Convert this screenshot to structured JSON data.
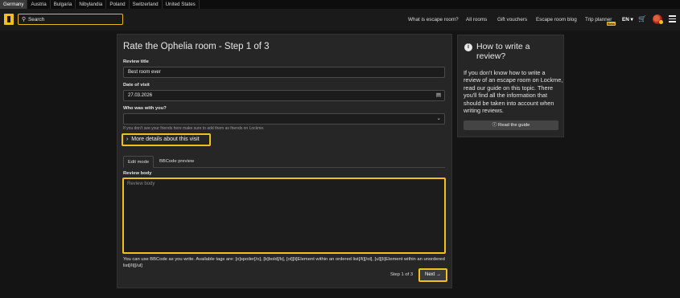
{
  "countries": [
    "Germany",
    "Austria",
    "Bulgaria",
    "Nibylandia",
    "Poland",
    "Switzerland",
    "United States"
  ],
  "search": {
    "placeholder": "Search"
  },
  "nav": {
    "escape_room": "What is escape room?",
    "all_rooms": "All rooms",
    "gift_vouchers": "Gift vouchers",
    "blog": "Escape room blog",
    "trip_planner": "Trip planner",
    "beta": "Beta",
    "lang": "EN"
  },
  "form": {
    "title": "Rate the Ophelia room - Step 1 of 3",
    "review_title_label": "Review title",
    "review_title_value": "Best room ever",
    "date_label": "Date of visit",
    "date_value": "27.03.2026",
    "who_label": "Who was with you?",
    "who_hint": "If you don't see your friends here make sure to add them as friends on Lockme.",
    "more_details": "More details about this visit",
    "tab_edit": "Edit mode",
    "tab_preview": "BBCode preview",
    "body_label": "Review body",
    "body_placeholder": "Review body",
    "bbcode_help": "You can use BBCode as you write. Available tags are: [o]spoiler[/o], [b]bold[/b], [ol][li]Element within an ordered list[/li][/ol], [ul][li]Element within an unordered list[/li][/ul]",
    "step": "Step 1 of 3",
    "next": "Next"
  },
  "side": {
    "title": "How to write a review?",
    "text": "If you don't know how to write a review of an escape room on Lockme, read our guide on this topic. There you'll find all the information that should be taken into account when writing reviews.",
    "button": "Read the guide"
  },
  "colors": {
    "accent": "#f2c01d",
    "background": "#141414",
    "card": "#262626"
  }
}
